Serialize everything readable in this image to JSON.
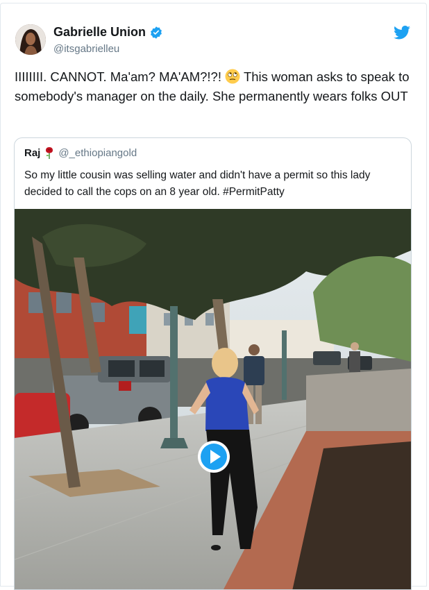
{
  "tweet": {
    "author_name": "Gabrielle Union",
    "author_handle": "@itsgabrielleu",
    "text_before_emoji": "IIIIIIII. CANNOT. Ma'am? MA'AM?!?! ",
    "text_after_emoji": " This woman asks to speak to somebody's manager on the daily. She permanently wears folks OUT",
    "emoji_name": "rolling-eyes-emoji",
    "verified": true,
    "brand_icon": "twitter-bird-icon",
    "accent_color": "#1da1f2"
  },
  "quoted_tweet": {
    "author_name": "Raj",
    "author_emoji": "rose-icon",
    "author_handle": "@_ethiopiangold",
    "text": "So my little cousin was selling water and didn't have a permit so this lady decided to call the cops on an 8 year old. #PermitPatty",
    "media": {
      "type": "video",
      "overlay_icon": "play-button-icon"
    }
  }
}
